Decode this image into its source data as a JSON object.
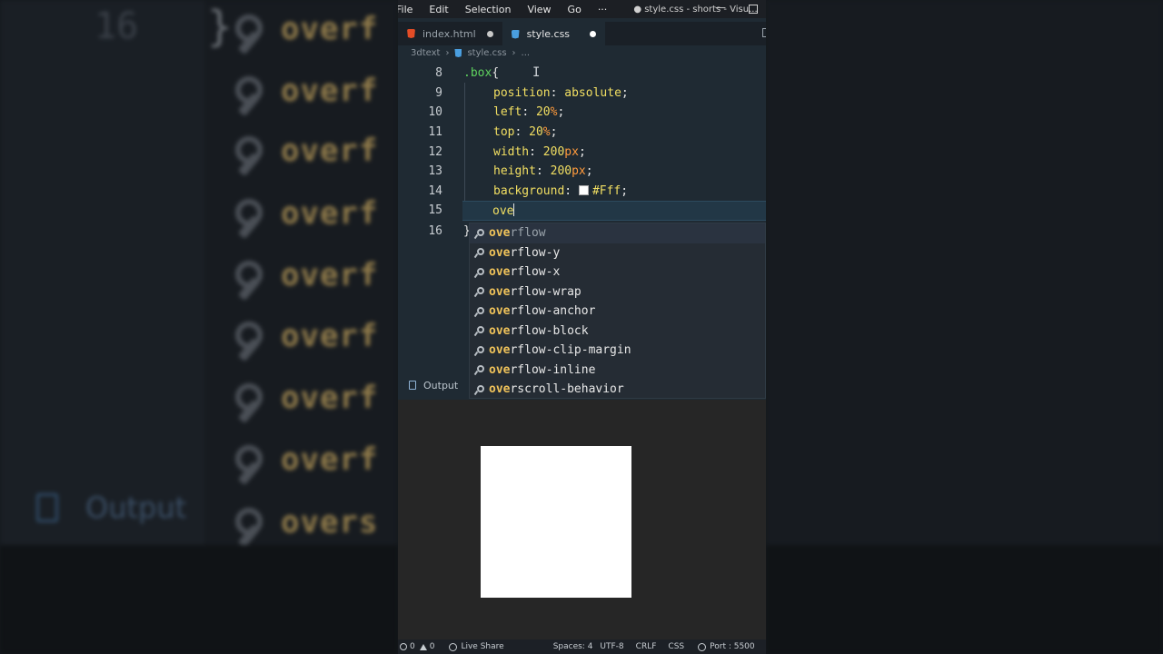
{
  "menu": [
    "File",
    "Edit",
    "Selection",
    "View",
    "Go",
    "···"
  ],
  "window_title": "● style.css - shorts - Visu...",
  "tabs": [
    {
      "label": "index.html",
      "icon": "html-file-icon",
      "modified": true
    },
    {
      "label": "style.css",
      "icon": "css-file-icon",
      "modified": true,
      "active": true
    }
  ],
  "breadcrumb": {
    "folder": "3dtext",
    "file": "style.css",
    "rest": "..."
  },
  "editor": {
    "lines": [
      {
        "n": "8",
        "selector": ".box",
        "brace": "{"
      },
      {
        "n": "9",
        "prop": "position",
        "value": "absolute"
      },
      {
        "n": "10",
        "prop": "left",
        "num": "20",
        "unit": "%"
      },
      {
        "n": "11",
        "prop": "top",
        "num": "20",
        "unit": "%"
      },
      {
        "n": "12",
        "prop": "width",
        "num": "200",
        "unit": "px"
      },
      {
        "n": "13",
        "prop": "height",
        "num": "200",
        "unit": "px"
      },
      {
        "n": "14",
        "prop": "background",
        "value": "#Fff"
      },
      {
        "n": "15",
        "typed": "ove"
      },
      {
        "n": "16",
        "brace": "}"
      }
    ]
  },
  "suggestions": [
    {
      "match": "ove",
      "rest": "rflow"
    },
    {
      "match": "ove",
      "rest": "rflow-y"
    },
    {
      "match": "ove",
      "rest": "rflow-x"
    },
    {
      "match": "ove",
      "rest": "rflow-wrap"
    },
    {
      "match": "ove",
      "rest": "rflow-anchor"
    },
    {
      "match": "ove",
      "rest": "rflow-block"
    },
    {
      "match": "ove",
      "rest": "rflow-clip-margin"
    },
    {
      "match": "ove",
      "rest": "rflow-inline"
    },
    {
      "match": "ove",
      "rest": "rscroll-behavior"
    }
  ],
  "output_label": "Output",
  "status": {
    "errors": "0",
    "warnings": "0",
    "live_share": "Live Share",
    "spaces": "Spaces: 4",
    "encoding": "UTF-8",
    "eol": "CRLF",
    "language": "CSS",
    "port": "Port : 5500"
  },
  "background_echo": {
    "line_number": "16",
    "brace": "}",
    "words": [
      "overf",
      "overf",
      "overf",
      "overf",
      "overf",
      "overf",
      "overf",
      "overf",
      "overs"
    ],
    "output": "Output"
  },
  "colors": {
    "property": "#f2df62",
    "unit": "#ff9a3c",
    "selector": "#5fd35f",
    "match": "#f0c35a",
    "preview_box": "#ffffff"
  }
}
